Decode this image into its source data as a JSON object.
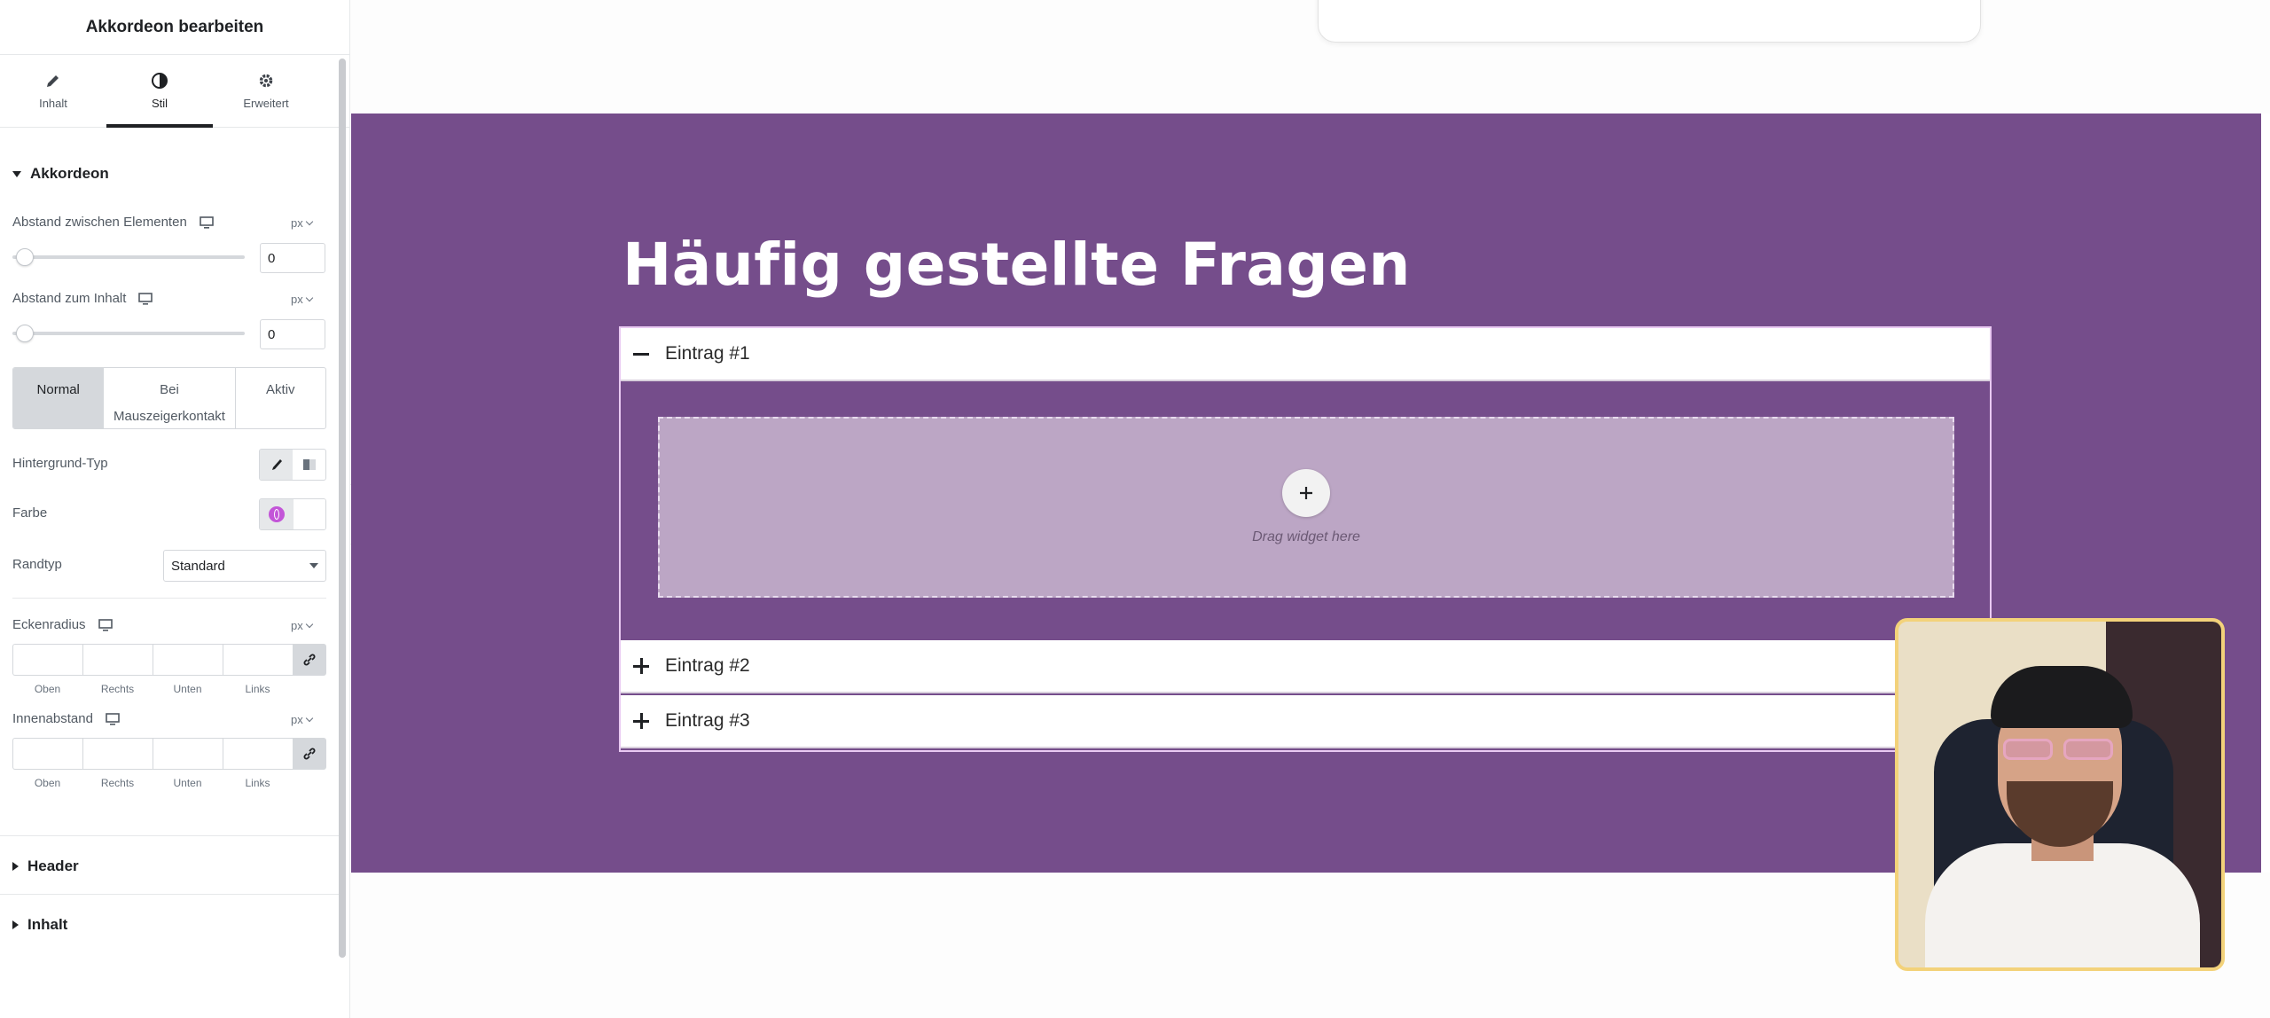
{
  "sidebar": {
    "title": "Akkordeon bearbeiten",
    "tabs": [
      {
        "label": "Inhalt",
        "icon": "pencil-icon"
      },
      {
        "label": "Stil",
        "icon": "contrast-icon"
      },
      {
        "label": "Erweitert",
        "icon": "gear-icon"
      }
    ],
    "active_tab": "Stil",
    "section_accordion": "Akkordeon",
    "spacing_between": {
      "label": "Abstand zwischen Elementen",
      "unit": "px",
      "value": "0"
    },
    "spacing_content": {
      "label": "Abstand zum Inhalt",
      "unit": "px",
      "value": "0"
    },
    "state_tabs": [
      "Normal",
      "Bei Mauszeigerkontakt",
      "Aktiv"
    ],
    "bg_type_label": "Hintergrund-Typ",
    "color_label": "Farbe",
    "border_type": {
      "label": "Randtyp",
      "value": "Standard"
    },
    "corner_radius": {
      "label": "Eckenradius",
      "unit": "px"
    },
    "padding": {
      "label": "Innenabstand",
      "unit": "px"
    },
    "dim_labels": [
      "Oben",
      "Rechts",
      "Unten",
      "Links"
    ],
    "section_header": "Header",
    "section_content": "Inhalt"
  },
  "canvas": {
    "faq_title": "Häufig gestellte Fragen",
    "entries": [
      "Eintrag #1",
      "Eintrag #2",
      "Eintrag #3"
    ],
    "drop_text": "Drag widget here",
    "section_color": "#754d8b"
  }
}
